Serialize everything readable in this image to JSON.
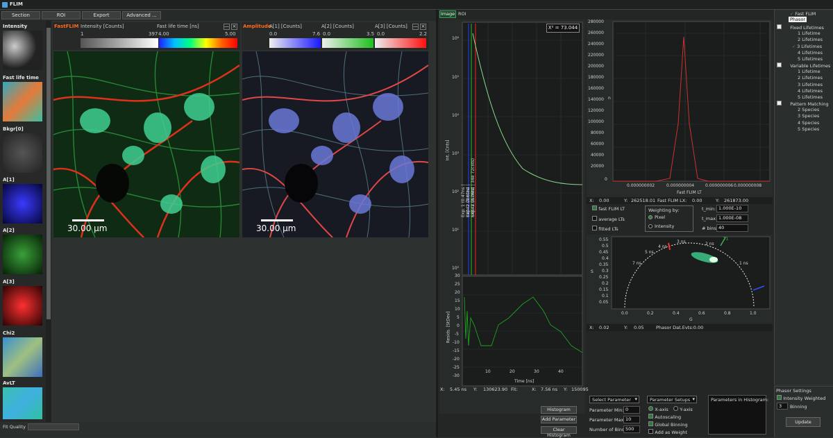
{
  "window": {
    "title": "FLIM"
  },
  "menu": [
    "Section",
    "ROI",
    "Export",
    "Advanced ..."
  ],
  "thumbnails": [
    {
      "label": "Intensity",
      "color": "#888888"
    },
    {
      "label": "Fast life time",
      "color": "#3aa0a0"
    },
    {
      "label": "Bkgr[0]",
      "color": "#3a3a3a"
    },
    {
      "label": "A[1]",
      "color": "#1818b0"
    },
    {
      "label": "A[2]",
      "color": "#1e6a1e"
    },
    {
      "label": "A[3]",
      "color": "#a01818"
    },
    {
      "label": "Chi2",
      "color": "#3a7fb0"
    },
    {
      "label": "AvLT",
      "color": "#3ab0a0"
    }
  ],
  "fastflim_panel": {
    "title": "FastFLIM",
    "scale1_label": "Intensity [Counts]",
    "scale1_min": "1",
    "scale1_max": "397",
    "scale2_label": "Fast life time [ns]",
    "scale2_min": "4.00",
    "scale2_max": "5.00",
    "scalebar": "30.00 µm"
  },
  "amplitude_panel": {
    "title": "Amplitude",
    "a1_label": "A[1] [Counts]",
    "a1_min": "0.0",
    "a1_max": "7.6",
    "a2_label": "A[2] [Counts]",
    "a2_min": "0.0",
    "a2_max": "3.5",
    "a3_label": "A[3] [Counts]",
    "a3_min": "0.0",
    "a3_max": "2.2",
    "scalebar": "30.00 µm"
  },
  "bottom_left": {
    "fit_quality": "Fit Quality"
  },
  "tabs": {
    "image": "Image",
    "roi": "ROI"
  },
  "decay_plot": {
    "chi2": "X² = 73.044",
    "ylabel": "Int. [Cnts]",
    "resid_label": "Resids. [StDev]",
    "xlabel": "Time [ns]",
    "yticks": [
      "10⁶",
      "10⁵",
      "10⁴",
      "10³",
      "10²",
      "10¹",
      "10⁰"
    ],
    "xticks": [
      "10",
      "20",
      "30",
      "40"
    ],
    "resid_ticks": [
      "30",
      "25",
      "20",
      "15",
      "10",
      "5",
      "0",
      "-5",
      "-10",
      "-15",
      "-20",
      "-25",
      "-30"
    ],
    "legend": [
      "Exp. 1 (0.47ns | 18042.28cnts)",
      "Exp. 2 (1.61ns | 54642.95cnts)",
      "Exp. 3 (3.76ns | 348 72cnts)"
    ],
    "status": {
      "x": "X:",
      "x_val": "5.45 ns",
      "y": "Y:",
      "y_val": "130623.90",
      "fit": "Fit:",
      "x2": "X:",
      "x2_val": "7.56 ns",
      "y2": "Y:",
      "y2_val": "150095"
    }
  },
  "histogram": {
    "xlabel": "Fast FLIM LT",
    "ylabel": "n",
    "yticks": [
      "280000",
      "260000",
      "240000",
      "220000",
      "200000",
      "180000",
      "160000",
      "140000",
      "120000",
      "100000",
      "80000",
      "60000",
      "40000",
      "20000",
      "0"
    ],
    "xticks": [
      "0.000000002",
      "0.000000004",
      "0.000000006",
      "0.000000008"
    ],
    "status": {
      "x": "X:",
      "x_val": "0.00",
      "y": "Y:",
      "y_val": "262518.01",
      "lx": "Fast FLIM LX:",
      "lx_val": "0.00",
      "y2": "Y:",
      "y2_val": "261873.00"
    },
    "fast_flim_lt": "fast FLIM LT",
    "average_lts": "average LTs",
    "fitted_lts": "fitted LTs",
    "weighting_title": "Weighting by:",
    "weight_pixel": "Pixel",
    "weight_intensity": "Intensity",
    "tmin_label": "t_min:",
    "tmin_val": "1.000E-10",
    "tmax_label": "t_max:",
    "tmax_val": "1.000E-08",
    "bins_label": "# bins:",
    "bins_val": "40"
  },
  "phasor": {
    "xlabel": "G",
    "ylabel": "S",
    "yticks": [
      "0.55",
      "0.5",
      "0.45",
      "0.4",
      "0.35",
      "0.3",
      "0.25",
      "0.2",
      "0.15",
      "0.1",
      "0.05"
    ],
    "xticks": [
      "0.0",
      "0.2",
      "0.4",
      "0.6",
      "0.8",
      "1.0"
    ],
    "ns_labels": [
      "4 ns",
      "3 ns",
      "2 ns",
      "5 ns",
      "7 ns",
      "1 ns"
    ],
    "tag": "T1",
    "status": {
      "x": "X:",
      "x_val": "0.02",
      "y": "Y:",
      "y_val": "0.05",
      "evts": "Phasor Dat.Evts:0.00"
    }
  },
  "histogram_buttons": [
    "Histogram",
    "Add Parameter",
    "Clear Histogram"
  ],
  "param_select": {
    "select": "Select Parameter",
    "min_label": "Parameter Min:",
    "min_val": "0",
    "max_label": "Parameter Max:",
    "max_val": "10",
    "bins_label": "Number of Bins:",
    "bins_val": "500"
  },
  "param_setups": {
    "title": "Parameter Setups",
    "xaxis": "X-axis",
    "yaxis": "Y-axis",
    "autoscaling": "Autoscaling",
    "global_binning": "Global Binning",
    "add_weight": "Add as Weight"
  },
  "params_in_hist": "Parameters in Histogram:",
  "tree": {
    "root": "Fast FLIM",
    "phasor": "Phasor",
    "fixed": "Fixed Lifetimes",
    "fixed_items": [
      "1 Lifetime",
      "2 Lifetimes",
      "3 Lifetimes",
      "4 Lifetimes",
      "5 Lifetimes"
    ],
    "variable": "Variable Lifetimes",
    "variable_items": [
      "1 Lifetime",
      "2 Lifetimes",
      "3 Lifetimes",
      "4 Lifetimes",
      "5 Lifetimes"
    ],
    "pattern": "Pattern Matching",
    "pattern_items": [
      "2 Species",
      "3 Species",
      "4 Species",
      "5 Species"
    ]
  },
  "phasor_settings": {
    "title": "Phasor Settings",
    "intensity_weighted": "Intensity Weighted",
    "binning_val": "3",
    "binning_label": "Binning",
    "update": "Update"
  }
}
